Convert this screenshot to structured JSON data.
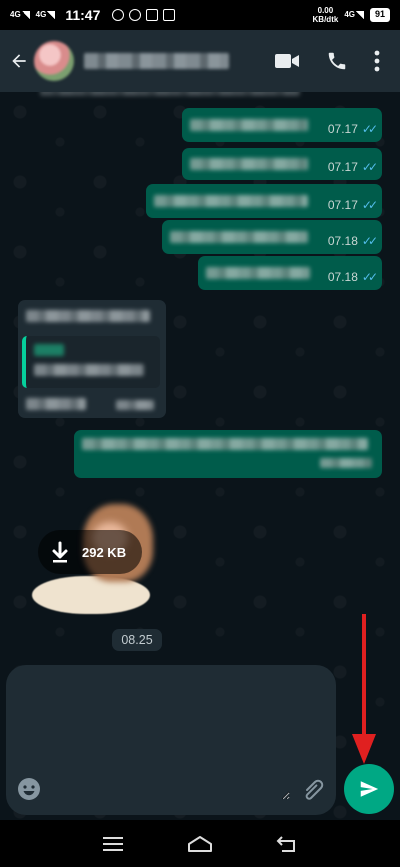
{
  "status_bar": {
    "net1": "4G",
    "net2": "4G",
    "time": "11:47",
    "speed_value": "0.00",
    "speed_unit": "KB/dtk",
    "net3": "4G",
    "battery": "91"
  },
  "header": {
    "contact_name": "",
    "icons": [
      "back-arrow-icon",
      "video-call-icon",
      "phone-icon",
      "more-vert-icon"
    ]
  },
  "messages": [
    {
      "time": "07.17"
    },
    {
      "time": "07.17"
    },
    {
      "time": "07.17"
    },
    {
      "time": "07.18"
    },
    {
      "time": "07.18"
    }
  ],
  "sticker": {
    "download_size": "292 KB"
  },
  "sticker_time": "08.25",
  "composer": {
    "placeholder": ""
  },
  "colors": {
    "header_bg": "#1f2c34",
    "chat_bg": "#0b141a",
    "outgoing_bubble": "#005c4b",
    "incoming_bubble": "#1f2c34",
    "accent": "#00a884",
    "read_ticks": "#53bdeb",
    "annotation_arrow": "#e02020"
  }
}
